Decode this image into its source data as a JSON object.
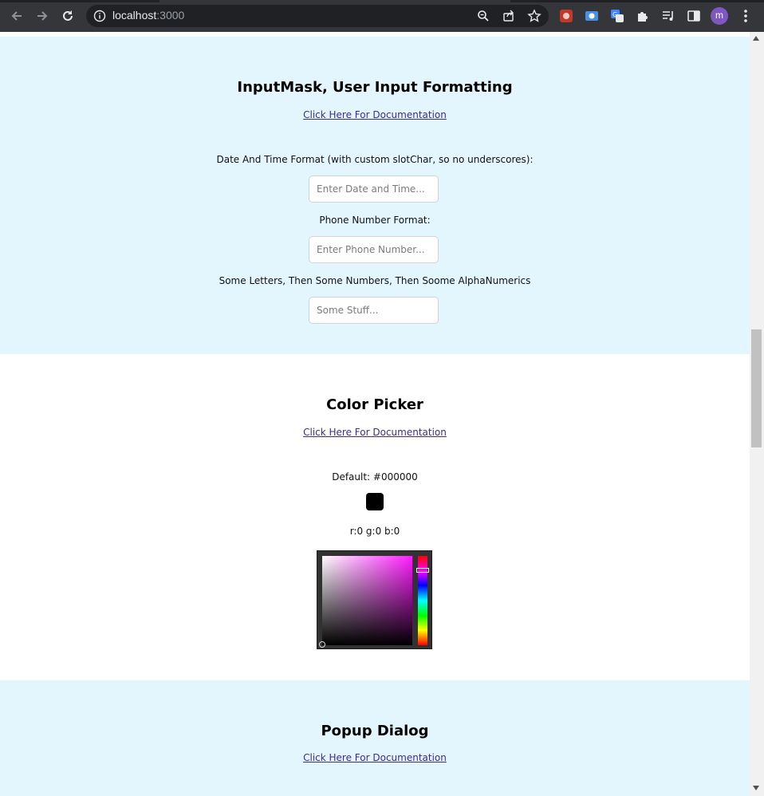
{
  "browser": {
    "url_host": "localhost",
    "url_port": ":3000",
    "avatar_letter": "m"
  },
  "input_mask": {
    "title": "InputMask, User Input Formatting",
    "doc_link": "Click Here For Documentation",
    "fields": [
      {
        "label": "Date And Time Format (with custom slotChar, so no underscores):",
        "placeholder": "Enter Date and Time...",
        "value": ""
      },
      {
        "label": "Phone Number Format:",
        "placeholder": "Enter Phone Number...",
        "value": ""
      },
      {
        "label": "Some Letters, Then Some Numbers, Then Soome AlphaNumerics",
        "placeholder": "Some Stuff...",
        "value": ""
      }
    ]
  },
  "color_picker": {
    "title": "Color Picker",
    "doc_link": "Click Here For Documentation",
    "default_label": "Default: #000000",
    "swatch_color": "#000000",
    "rgb_label": "r:0 g:0 b:0"
  },
  "popup_dialog": {
    "title": "Popup Dialog",
    "doc_link": "Click Here For Documentation"
  },
  "colors": {
    "section_bg": "#e3f5fd",
    "link": "#3b2d8f",
    "chrome_bg": "#35363a"
  }
}
